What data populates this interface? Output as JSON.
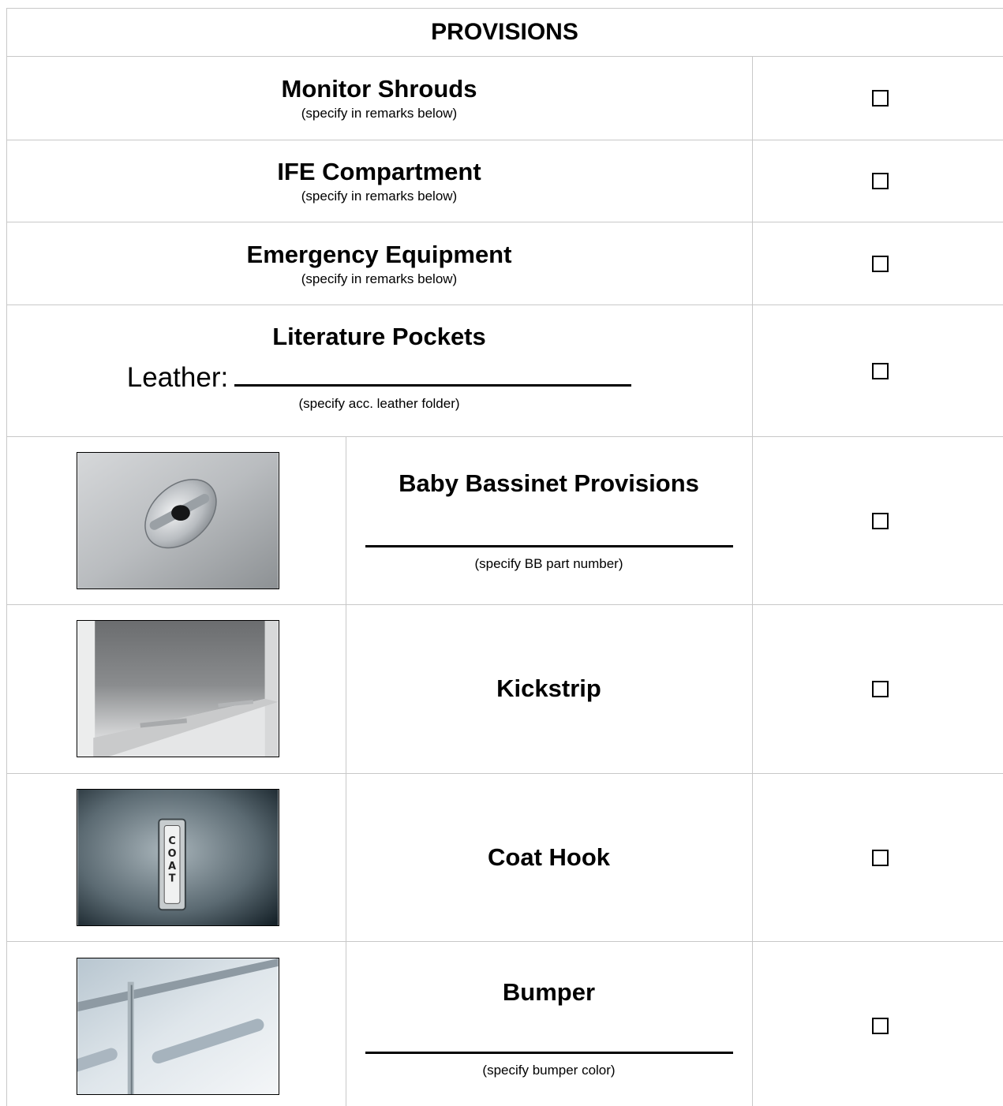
{
  "header": {
    "title": "PROVISIONS"
  },
  "rows": [
    {
      "title": "Monitor Shrouds",
      "note": "(specify in remarks below)"
    },
    {
      "title": "IFE Compartment",
      "note": "(specify in remarks below)"
    },
    {
      "title": "Emergency Equipment",
      "note": "(specify in remarks below)"
    },
    {
      "title": "Literature Pockets",
      "field_label": "Leather:",
      "note": "(specify acc. leather folder)"
    },
    {
      "title": "Baby Bassinet Provisions",
      "note": "(specify BB part number)",
      "image_icon": "bassinet-fitting-icon"
    },
    {
      "title": "Kickstrip",
      "image_icon": "kickstrip-panel-icon"
    },
    {
      "title": "Coat Hook",
      "image_icon": "coat-hook-icon",
      "image_text": "COAT"
    },
    {
      "title": "Bumper",
      "note": "(specify bumper color)",
      "image_icon": "bumper-strip-icon"
    }
  ],
  "colors": {
    "border": "#c8c8c8",
    "text": "#000000"
  }
}
